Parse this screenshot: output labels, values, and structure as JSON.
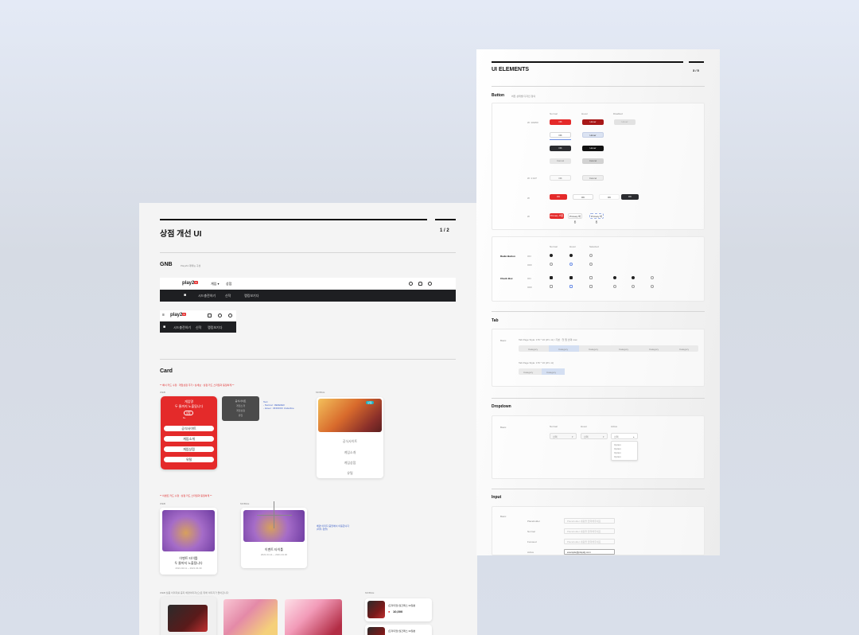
{
  "sheet1": {
    "title": "상점 개선 UI",
    "page": "1 / 2",
    "gnb": {
      "title": "GNB",
      "desc": "Play2G 대메뉴 구성",
      "logo": "play2",
      "menu": [
        "게임 ▾",
        "상점"
      ],
      "bar_items": [
        "시드충전하기",
        "신작",
        "랭킹보기다"
      ],
      "mobile_bar_items": [
        "시드충전하기",
        "신작",
        "랭킹보기다"
      ]
    },
    "card": {
      "title": "Card",
      "note1": "** 배너 카드 수정 : 게임상점 추가 / 상세보 : 상점 카드 스타일과 동일하게 **",
      "web_label": "WEB",
      "mobile_label": "MOBILE",
      "red_card": {
        "line1": "게임명",
        "line2": "두 줄까지 노출됩니다",
        "badge": "상점",
        "counter": "9+",
        "buttons": [
          "공식사이트",
          "게임소개",
          "게임상점",
          "유틸"
        ]
      },
      "dark_list": [
        "공식사이트",
        "게임소개",
        "게임상점",
        "유틸"
      ],
      "spec_text": [
        "Text",
        "- Normal : #E0E0E0",
        "- Hover : #FFFFFF Underline"
      ],
      "mobile_menu": [
        "공식사이트",
        "게임소개",
        "게임상점",
        "유틸"
      ],
      "note2": "** 이벤트 카드 수정 : 상점 카드 스타일과 동일하게 **",
      "event_web": {
        "title1": "이벤트 타이틀",
        "title2": "두 줄까지 노출됩니다",
        "date": "2021.04.11 ~ 2021.04.30"
      },
      "event_mobile": {
        "title1": "이벤트 타이틀",
        "date": "2021.04.11 ~ 2021.04.30"
      },
      "event_note": [
        "배경 이미지 중앙에서 이동합니다",
        "(좌우 정렬)"
      ],
      "note3": "WEB   상품 이미지를 중지 배경이미지(으)로 위해 이미지가 들어갑니다",
      "mobile_label2": "MOBILE",
      "products": [
        {
          "name": "[프리미엄] 월간패스 30일분",
          "price": "10,000"
        },
        {
          "name": "[프리미엄] 월간패스 30일분",
          "price": ""
        }
      ]
    }
  },
  "sheet2": {
    "title": "UI ELEMENTS",
    "page": "3 / 5",
    "button": {
      "title": "Button",
      "desc": "버튼 상태별 디자인 정의",
      "cols": [
        "Normal",
        "Hover",
        "Disabled"
      ],
      "rows": [
        "W: 100/60",
        "W: 1:107",
        "W",
        "W"
      ],
      "labels": [
        "OK",
        "Hover",
        "OK",
        "Hover",
        "OK",
        "Hover",
        "Cancel",
        "Cancel",
        "OK",
        "Cancel",
        "OK",
        "OK",
        "OK",
        "OK",
        "Primary 버튼",
        "Primary 버튼",
        "Primary 버튼"
      ]
    },
    "radio": {
      "rows": [
        "Radio Button",
        "Check Box"
      ],
      "cols": [
        "Normal",
        "Hover",
        "Selected"
      ],
      "sub": [
        "ON",
        "OFF",
        "ON",
        "OFF"
      ],
      "label": "TEXT"
    },
    "tab": {
      "title": "Tab",
      "row_label": "Basic",
      "desc1": "Tab Page Style: 176 * 16 (W x H) / 기본 : 첫 탭 선택 now",
      "desc2": "Tab Page Style: 176 * 16 (W x H)",
      "items": [
        "Category",
        "Category",
        "Category",
        "Category",
        "Category",
        "Category"
      ],
      "items2": [
        "Category",
        "Category"
      ]
    },
    "dropdown": {
      "title": "Dropdown",
      "row_label": "Basic",
      "cols": [
        "Normal",
        "Hover",
        "Active"
      ],
      "value": "선택",
      "options": [
        "Option",
        "Option",
        "Option",
        "Option"
      ]
    },
    "input": {
      "title": "Input",
      "row_label": "Basic",
      "rows": [
        "Placeholder",
        "Normal",
        "Focused",
        "Active"
      ],
      "placeholder": "Placeholder 내용을 입력해주세요",
      "value": "example@play2g.com"
    }
  },
  "colors": {
    "accent": "#e42a2a",
    "dark": "#1e1f22",
    "blue": "#3b5ec6"
  }
}
